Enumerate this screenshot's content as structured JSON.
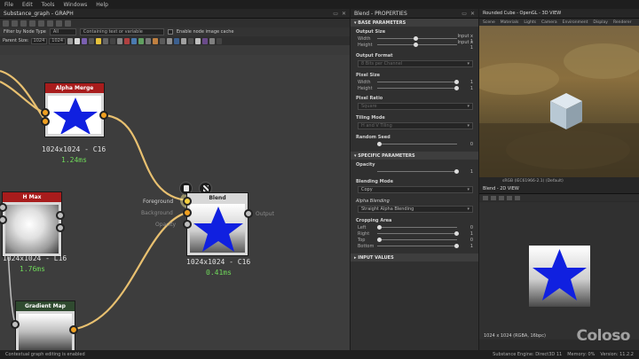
{
  "menubar": [
    "File",
    "Edit",
    "Tools",
    "Windows",
    "Help"
  ],
  "graph": {
    "title": "Substance_graph - GRAPH",
    "filter_label": "Filter by Node Type",
    "filter_value": "All",
    "search_placeholder": "Containing text or variable",
    "node_cache_label": "Enable node image cache",
    "parent_size_label": "Parent Size:",
    "parent_size_value": "1024",
    "parent_size_value2": "1024",
    "nodes": {
      "alpha_merge": {
        "title": "Alpha Merge",
        "info": "1024x1024 - C16",
        "time": "1.24ms",
        "color": "#a81c1c"
      },
      "blend": {
        "title": "Blend",
        "info": "1024x1024 - C16",
        "time": "0.41ms",
        "inputs": [
          "Foreground",
          "Background",
          "Opacity"
        ],
        "output": "Output"
      },
      "h_max": {
        "title": "H Max",
        "info": "1024x1024 - L16",
        "time": "1.76ms",
        "color": "#a81c1c"
      },
      "gradient_map": {
        "title": "Gradient Map",
        "color": "#2f4a2f"
      }
    }
  },
  "properties": {
    "title": "Blend - PROPERTIES",
    "base_section": "BASE PARAMETERS",
    "output_size_label": "Output Size",
    "width_label": "Width",
    "height_label": "Height",
    "output_size_width": "Input x 1",
    "output_size_height": "Input x 1",
    "output_format_label": "Output Format",
    "output_format_value": "8 Bits per Channel",
    "pixel_size_label": "Pixel Size",
    "pixel_width": "1",
    "pixel_height": "1",
    "pixel_ratio_label": "Pixel Ratio",
    "pixel_ratio_value": "Square",
    "tiling_label": "Tiling Mode",
    "tiling_value": "H and V Tiling",
    "random_seed_label": "Random Seed",
    "random_seed_value": "0",
    "specific_section": "SPECIFIC PARAMETERS",
    "opacity_label": "Opacity",
    "opacity_value": "1",
    "blending_mode_label": "Blending Mode",
    "blending_mode_value": "Copy",
    "alpha_blending_label": "Alpha Blending",
    "alpha_blending_value": "Straight Alpha Blending",
    "cropping_label": "Cropping Area",
    "crop_left_label": "Left",
    "crop_right_label": "Right",
    "crop_top_label": "Top",
    "crop_bottom_label": "Bottom",
    "crop_left": "0",
    "crop_right": "1",
    "crop_top": "0",
    "crop_bottom": "1",
    "input_values_section": "INPUT VALUES",
    "opacity_level": 1.0
  },
  "view3d": {
    "title": "Rounded Cube - OpenGL - 3D VIEW",
    "menu": [
      "Scene",
      "Materials",
      "Lights",
      "Camera",
      "Environment",
      "Display",
      "Renderer"
    ],
    "status": "sRGB (IEC61966-2.1) (Default)"
  },
  "view2d": {
    "title": "Blend - 2D VIEW",
    "resolution": "1024 x 1024 (RGBA, 16bpc)",
    "watermark": "Coloso"
  },
  "statusbar": {
    "left": "Contextual graph editing is enabled",
    "engine": "Substance Engine: Direct3D 11",
    "memory": "Memory: 0%",
    "version": "Version: 11.2.2"
  },
  "colors": {
    "accent": "#f0a020",
    "star": "#1020e0",
    "time_green": "#6fd95a",
    "node_red": "#a81c1c"
  }
}
